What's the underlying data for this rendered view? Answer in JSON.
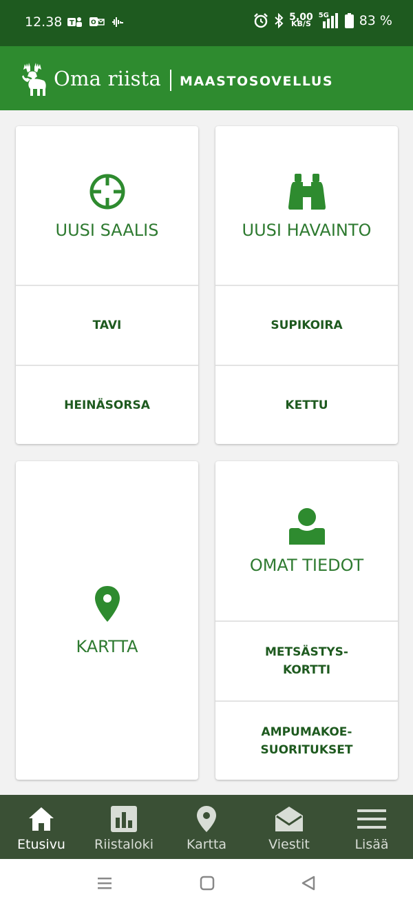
{
  "status_bar": {
    "time": "12.38",
    "net_speed_value": "5,00",
    "net_speed_unit": "KB/S",
    "network": "5G",
    "battery": "83 %"
  },
  "header": {
    "title": "Oma riista",
    "subtitle": "MAASTOSOVELLUS"
  },
  "cards": {
    "saalis": {
      "label": "UUSI SAALIS",
      "items": [
        "TAVI",
        "HEINÄSORSA"
      ]
    },
    "havainto": {
      "label": "UUSI HAVAINTO",
      "items": [
        "SUPIKOIRA",
        "KETTU"
      ]
    },
    "kartta": {
      "label": "KARTTA"
    },
    "omat": {
      "label": "OMAT TIEDOT",
      "items": [
        [
          "METSÄSTYS-",
          "KORTTI"
        ],
        [
          "AMPUMAKOE-",
          "SUORITUKSET"
        ]
      ]
    }
  },
  "nav": {
    "items": [
      {
        "label": "Etusivu",
        "icon": "home-icon",
        "active": true
      },
      {
        "label": "Riistaloki",
        "icon": "bar-chart-icon",
        "active": false
      },
      {
        "label": "Kartta",
        "icon": "map-pin-icon",
        "active": false
      },
      {
        "label": "Viestit",
        "icon": "envelope-icon",
        "active": false
      },
      {
        "label": "Lisää",
        "icon": "menu-icon",
        "active": false
      }
    ]
  },
  "colors": {
    "status_bar": "#1e5a1f",
    "header": "#2e8b2f",
    "accent": "#2e8b2f",
    "bottom_nav": "#3a5035"
  }
}
